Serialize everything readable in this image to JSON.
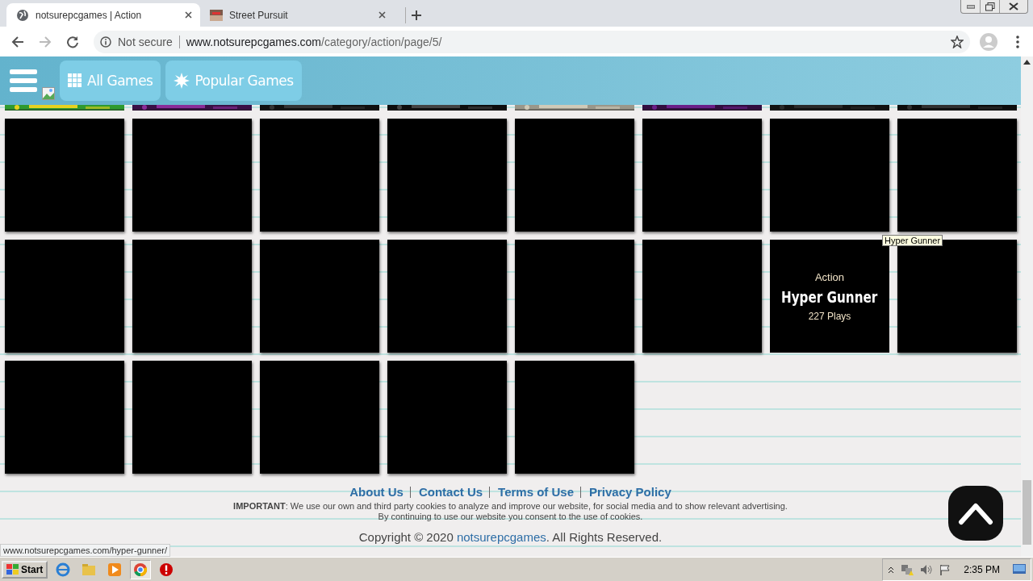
{
  "browser": {
    "tabs": [
      {
        "title": "notsurepcgames | Action",
        "selected": true
      },
      {
        "title": "Street Pursuit",
        "selected": false
      }
    ],
    "security": "Not secure",
    "url_host": "www.notsurepcgames.com",
    "url_path": "/category/action/page/5/"
  },
  "nav": {
    "buttons": [
      {
        "label": "All Games"
      },
      {
        "label": "Popular Games"
      }
    ]
  },
  "tiles": [
    {
      "hovered": false
    },
    {
      "hovered": false
    },
    {
      "hovered": false
    },
    {
      "hovered": false
    },
    {
      "hovered": false
    },
    {
      "hovered": false
    },
    {
      "hovered": false
    },
    {
      "hovered": false
    },
    {
      "hovered": false
    },
    {
      "hovered": false
    },
    {
      "hovered": false
    },
    {
      "hovered": false
    },
    {
      "hovered": false
    },
    {
      "hovered": false
    },
    {
      "hovered": true,
      "category": "Action",
      "title": "Hyper Gunner",
      "plays": "227 Plays"
    },
    {
      "hovered": false
    },
    {
      "hovered": false
    },
    {
      "hovered": false
    },
    {
      "hovered": false
    },
    {
      "hovered": false
    },
    {
      "hovered": false
    }
  ],
  "tooltip": "Hyper Gunner",
  "footer": {
    "links": [
      "About Us",
      "Contact Us",
      "Terms of Use",
      "Privacy Policy"
    ],
    "notice": "**IMPORTANT**: We use our own and third party cookies to analyze and improve our website, for social media and to show relevant advertising.",
    "notice_line2": "By continuing to use our website you consent to the use of cookies.",
    "copyright_prefix": "Copyright © 2020",
    "copyright_link": "notsurepcgames",
    "copyright_suffix": ". All Rights Reserved."
  },
  "status_url": "www.notsurepcgames.com/hyper-gunner/",
  "taskbar": {
    "start": "Start",
    "clock": "2:35 PM"
  }
}
